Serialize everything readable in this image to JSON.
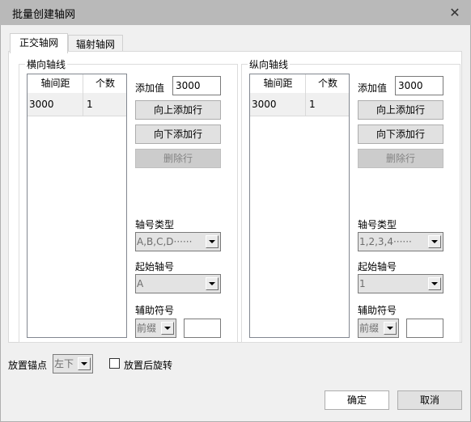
{
  "window": {
    "title": "批量创建轴网",
    "close_icon": "close-icon"
  },
  "tabs": [
    {
      "label": "正交轴网",
      "active": true
    },
    {
      "label": "辐射轴网",
      "active": false
    }
  ],
  "horizontal": {
    "group_title": "横向轴线",
    "grid": {
      "columns": [
        "轴间距",
        "个数"
      ],
      "rows": [
        [
          "3000",
          "1"
        ]
      ]
    },
    "add_value_label": "添加值",
    "add_value": "3000",
    "add_above_label": "向上添加行",
    "add_below_label": "向下添加行",
    "delete_row_label": "删除行",
    "axis_type_label": "轴号类型",
    "axis_type_value": "A,B,C,D······",
    "start_axis_label": "起始轴号",
    "start_axis_value": "A",
    "aux_symbol_label": "辅助符号",
    "aux_symbol_type": "前缀",
    "aux_symbol_value": ""
  },
  "vertical": {
    "group_title": "纵向轴线",
    "grid": {
      "columns": [
        "轴间距",
        "个数"
      ],
      "rows": [
        [
          "3000",
          "1"
        ]
      ]
    },
    "add_value_label": "添加值",
    "add_value": "3000",
    "add_above_label": "向上添加行",
    "add_below_label": "向下添加行",
    "delete_row_label": "删除行",
    "axis_type_label": "轴号类型",
    "axis_type_value": "1,2,3,4······",
    "start_axis_label": "起始轴号",
    "start_axis_value": "1",
    "aux_symbol_label": "辅助符号",
    "aux_symbol_type": "前缀",
    "aux_symbol_value": ""
  },
  "footer": {
    "anchor_label": "放置锚点",
    "anchor_value": "左下",
    "rotate_label": "放置后旋转",
    "rotate_checked": false,
    "ok_label": "确定",
    "cancel_label": "取消"
  }
}
